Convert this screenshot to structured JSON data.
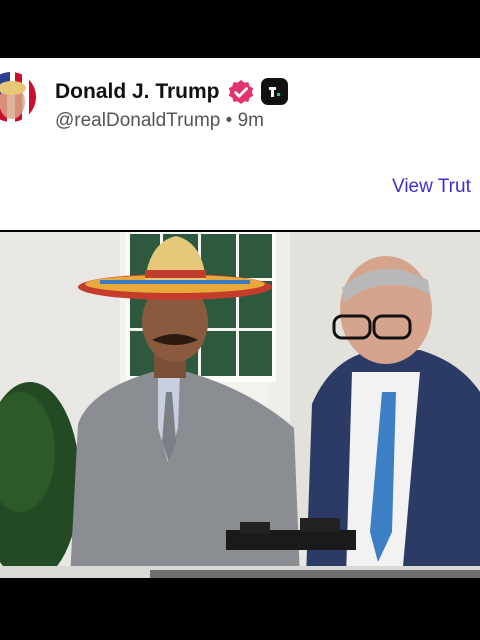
{
  "overlay": {
    "emojis": [
      "😂",
      "😂",
      "😂"
    ]
  },
  "post": {
    "author_name": "Donald J. Trump",
    "handle": "@realDonaldTrump",
    "separator": "•",
    "time_ago": "9m",
    "view_link": "View Trut"
  },
  "icons": {
    "verified": "verified-badge-icon",
    "platform": "truth-social-logo-icon"
  },
  "colors": {
    "link": "#3d2fc9",
    "verified_badge": "#e3326f",
    "background": "#000000",
    "card": "#ffffff"
  }
}
